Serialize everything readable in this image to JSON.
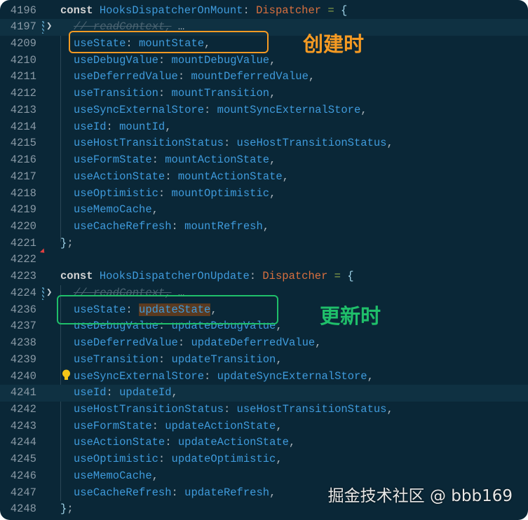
{
  "lines": [
    {
      "n": "4196",
      "t": [
        [
          "kw",
          "const "
        ],
        [
          "id",
          "HooksDispatcherOnMount"
        ],
        [
          "pu",
          ": "
        ],
        [
          "ty",
          "Dispatcher"
        ],
        [
          "op",
          " = "
        ],
        [
          "br",
          "{"
        ]
      ]
    },
    {
      "n": "4197",
      "fold": true,
      "hl": true,
      "t": [
        [
          "cm",
          "// readContext,"
        ],
        [
          "pu",
          " …"
        ]
      ]
    },
    {
      "n": "4209",
      "t": [
        [
          "id",
          "useState"
        ],
        [
          "pu",
          ": "
        ],
        [
          "id",
          "mountState"
        ],
        [
          "pu",
          ","
        ]
      ]
    },
    {
      "n": "4210",
      "t": [
        [
          "id",
          "useDebugValue"
        ],
        [
          "pu",
          ": "
        ],
        [
          "id",
          "mountDebugValue"
        ],
        [
          "pu",
          ","
        ]
      ]
    },
    {
      "n": "4211",
      "t": [
        [
          "id",
          "useDeferredValue"
        ],
        [
          "pu",
          ": "
        ],
        [
          "id",
          "mountDeferredValue"
        ],
        [
          "pu",
          ","
        ]
      ]
    },
    {
      "n": "4212",
      "t": [
        [
          "id",
          "useTransition"
        ],
        [
          "pu",
          ": "
        ],
        [
          "id",
          "mountTransition"
        ],
        [
          "pu",
          ","
        ]
      ]
    },
    {
      "n": "4213",
      "t": [
        [
          "id",
          "useSyncExternalStore"
        ],
        [
          "pu",
          ": "
        ],
        [
          "id",
          "mountSyncExternalStore"
        ],
        [
          "pu",
          ","
        ]
      ]
    },
    {
      "n": "4214",
      "t": [
        [
          "id",
          "useId"
        ],
        [
          "pu",
          ": "
        ],
        [
          "id",
          "mountId"
        ],
        [
          "pu",
          ","
        ]
      ]
    },
    {
      "n": "4215",
      "t": [
        [
          "id",
          "useHostTransitionStatus"
        ],
        [
          "pu",
          ": "
        ],
        [
          "id",
          "useHostTransitionStatus"
        ],
        [
          "pu",
          ","
        ]
      ]
    },
    {
      "n": "4216",
      "t": [
        [
          "id",
          "useFormState"
        ],
        [
          "pu",
          ": "
        ],
        [
          "id",
          "mountActionState"
        ],
        [
          "pu",
          ","
        ]
      ]
    },
    {
      "n": "4217",
      "t": [
        [
          "id",
          "useActionState"
        ],
        [
          "pu",
          ": "
        ],
        [
          "id",
          "mountActionState"
        ],
        [
          "pu",
          ","
        ]
      ]
    },
    {
      "n": "4218",
      "t": [
        [
          "id",
          "useOptimistic"
        ],
        [
          "pu",
          ": "
        ],
        [
          "id",
          "mountOptimistic"
        ],
        [
          "pu",
          ","
        ]
      ]
    },
    {
      "n": "4219",
      "t": [
        [
          "id",
          "useMemoCache"
        ],
        [
          "pu",
          ","
        ]
      ]
    },
    {
      "n": "4220",
      "t": [
        [
          "id",
          "useCacheRefresh"
        ],
        [
          "pu",
          ": "
        ],
        [
          "id",
          "mountRefresh"
        ],
        [
          "pu",
          ","
        ]
      ]
    },
    {
      "n": "4221",
      "close": true,
      "t": [
        [
          "br",
          "}"
        ],
        [
          "pu",
          ";"
        ]
      ]
    },
    {
      "n": "4222",
      "t": []
    },
    {
      "n": "4223",
      "t": [
        [
          "kw",
          "const "
        ],
        [
          "id",
          "HooksDispatcherOnUpdate"
        ],
        [
          "pu",
          ": "
        ],
        [
          "ty",
          "Dispatcher"
        ],
        [
          "op",
          " = "
        ],
        [
          "br",
          "{"
        ]
      ]
    },
    {
      "n": "4224",
      "fold": true,
      "t": [
        [
          "cm",
          "// readContext,"
        ],
        [
          "pu",
          " …"
        ]
      ]
    },
    {
      "n": "4236",
      "t": [
        [
          "id",
          "useState"
        ],
        [
          "pu",
          ": "
        ],
        [
          "id sel",
          "updateState"
        ],
        [
          "pu",
          ","
        ]
      ]
    },
    {
      "n": "4237",
      "t": [
        [
          "id",
          "useDebugValue"
        ],
        [
          "pu",
          ": "
        ],
        [
          "id",
          "updateDebugValue"
        ],
        [
          "pu",
          ","
        ]
      ]
    },
    {
      "n": "4238",
      "t": [
        [
          "id",
          "useDeferredValue"
        ],
        [
          "pu",
          ": "
        ],
        [
          "id",
          "updateDeferredValue"
        ],
        [
          "pu",
          ","
        ]
      ]
    },
    {
      "n": "4239",
      "t": [
        [
          "id",
          "useTransition"
        ],
        [
          "pu",
          ": "
        ],
        [
          "id",
          "updateTransition"
        ],
        [
          "pu",
          ","
        ]
      ]
    },
    {
      "n": "4240",
      "t": [
        [
          "id",
          "useSyncExternalStore"
        ],
        [
          "pu",
          ": "
        ],
        [
          "id",
          "updateSyncExternalStore"
        ],
        [
          "pu",
          ","
        ]
      ]
    },
    {
      "n": "4241",
      "hl": true,
      "t": [
        [
          "id",
          "useId"
        ],
        [
          "pu",
          ": "
        ],
        [
          "id",
          "updateId"
        ],
        [
          "pu",
          ","
        ]
      ]
    },
    {
      "n": "4242",
      "t": [
        [
          "id",
          "useHostTransitionStatus"
        ],
        [
          "pu",
          ": "
        ],
        [
          "id",
          "useHostTransitionStatus"
        ],
        [
          "pu",
          ","
        ]
      ]
    },
    {
      "n": "4243",
      "t": [
        [
          "id",
          "useFormState"
        ],
        [
          "pu",
          ": "
        ],
        [
          "id",
          "updateActionState"
        ],
        [
          "pu",
          ","
        ]
      ]
    },
    {
      "n": "4244",
      "t": [
        [
          "id",
          "useActionState"
        ],
        [
          "pu",
          ": "
        ],
        [
          "id",
          "updateActionState"
        ],
        [
          "pu",
          ","
        ]
      ]
    },
    {
      "n": "4245",
      "t": [
        [
          "id",
          "useOptimistic"
        ],
        [
          "pu",
          ": "
        ],
        [
          "id",
          "updateOptimistic"
        ],
        [
          "pu",
          ","
        ]
      ]
    },
    {
      "n": "4246",
      "t": [
        [
          "id",
          "useMemoCache"
        ],
        [
          "pu",
          ","
        ]
      ]
    },
    {
      "n": "4247",
      "t": [
        [
          "id",
          "useCacheRefresh"
        ],
        [
          "pu",
          ": "
        ],
        [
          "id",
          "updateRefresh"
        ],
        [
          "pu",
          ","
        ]
      ]
    },
    {
      "n": "4248",
      "close": true,
      "t": [
        [
          "br",
          "}"
        ],
        [
          "pu",
          ";"
        ]
      ]
    }
  ],
  "annotations": {
    "mount_label": "创建时",
    "update_label": "更新时",
    "mount_color": "#f59a23",
    "update_color": "#1fbf6a"
  },
  "watermark": "掘金技术社区 @ bbb169"
}
